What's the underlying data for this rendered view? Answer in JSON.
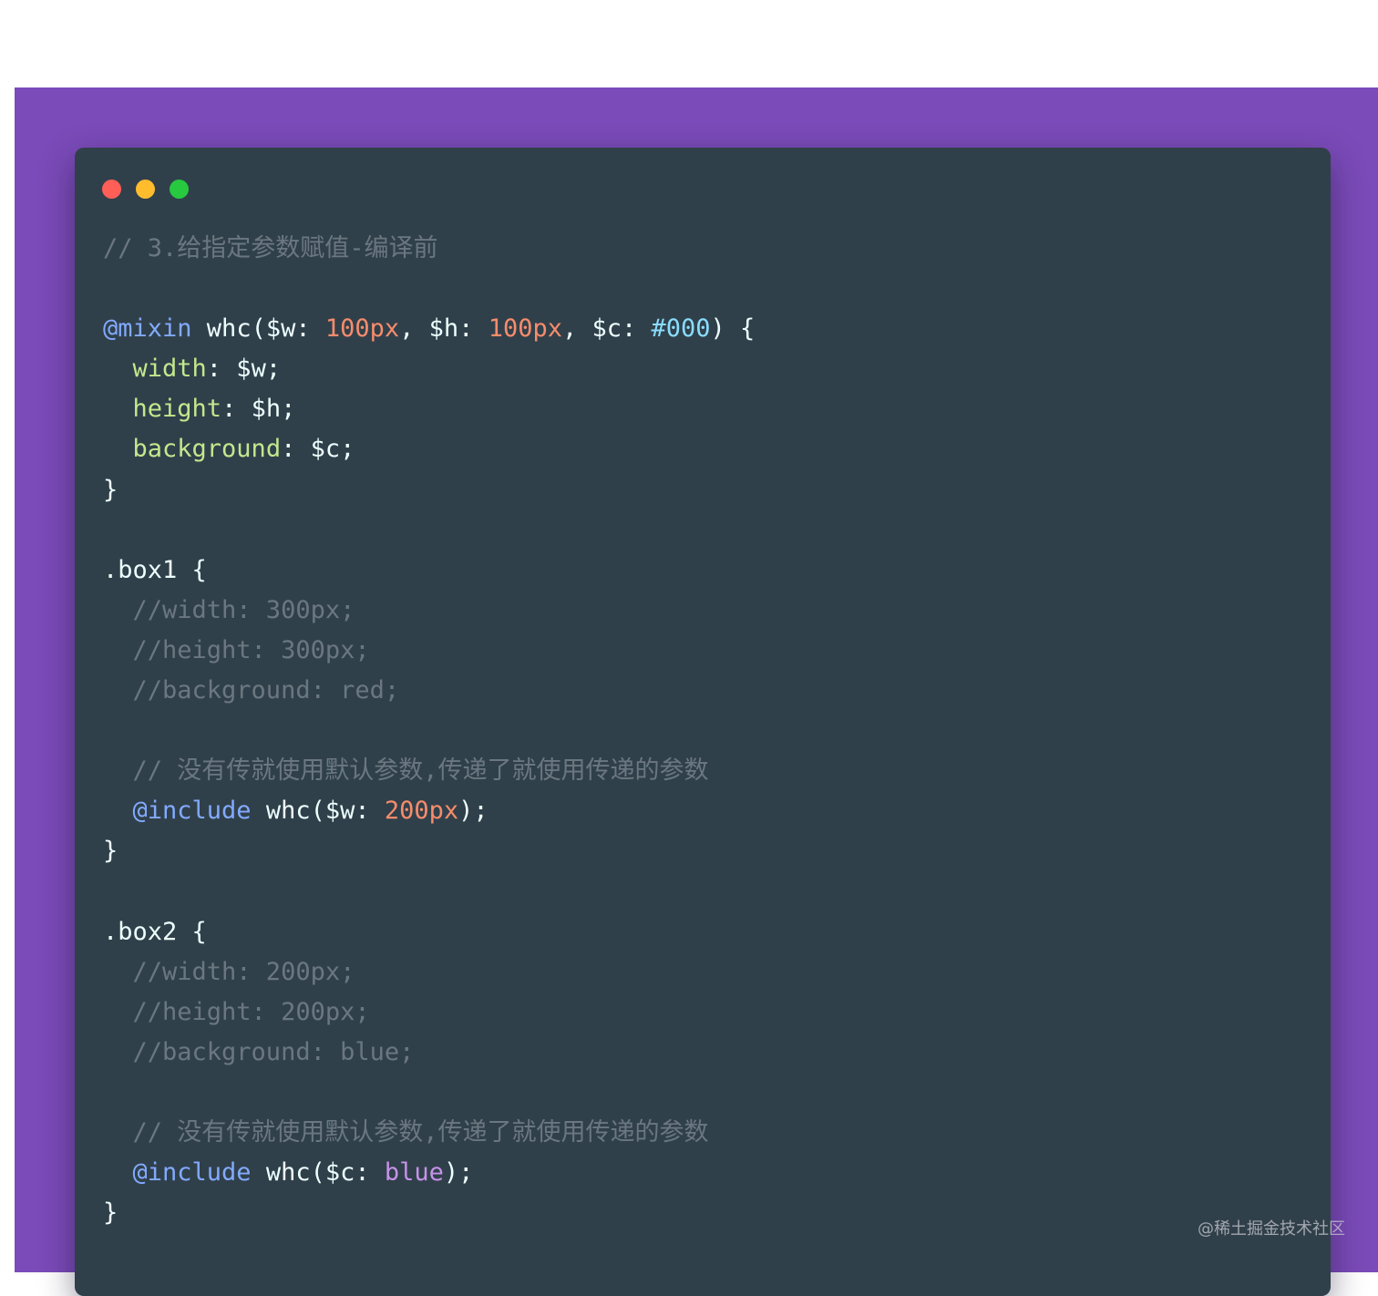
{
  "window": {
    "traffic_lights": [
      {
        "name": "close",
        "color": "#ff5f56"
      },
      {
        "name": "minimize",
        "color": "#ffbd2e"
      },
      {
        "name": "maximize",
        "color": "#27c93f"
      }
    ]
  },
  "colors": {
    "frame_background": "#7b4bb9",
    "card_background": "#30404a",
    "comment": "#6b7780",
    "at_rule": "#82aaff",
    "number": "#f78c6c",
    "hex": "#89ddff",
    "property": "#c3e88d",
    "string": "#c792ea",
    "plain": "#eeffff"
  },
  "code": {
    "lines": [
      [
        {
          "t": "// 3.给指定参数赋值-编译前",
          "k": "comment"
        }
      ],
      [],
      [
        {
          "t": "@mixin",
          "k": "at"
        },
        {
          "t": " whc($w: ",
          "k": "plain"
        },
        {
          "t": "100px",
          "k": "num"
        },
        {
          "t": ", $h: ",
          "k": "plain"
        },
        {
          "t": "100px",
          "k": "num"
        },
        {
          "t": ", $c: ",
          "k": "plain"
        },
        {
          "t": "#000",
          "k": "hex"
        },
        {
          "t": ") {",
          "k": "plain"
        }
      ],
      [
        {
          "t": "  ",
          "k": "plain"
        },
        {
          "t": "width",
          "k": "prop"
        },
        {
          "t": ": $w;",
          "k": "plain"
        }
      ],
      [
        {
          "t": "  ",
          "k": "plain"
        },
        {
          "t": "height",
          "k": "prop"
        },
        {
          "t": ": $h;",
          "k": "plain"
        }
      ],
      [
        {
          "t": "  ",
          "k": "plain"
        },
        {
          "t": "background",
          "k": "prop"
        },
        {
          "t": ": $c;",
          "k": "plain"
        }
      ],
      [
        {
          "t": "}",
          "k": "plain"
        }
      ],
      [],
      [
        {
          "t": ".box1 {",
          "k": "plain"
        }
      ],
      [
        {
          "t": "  //width: 300px;",
          "k": "comment"
        }
      ],
      [
        {
          "t": "  //height: 300px;",
          "k": "comment"
        }
      ],
      [
        {
          "t": "  //background: red;",
          "k": "comment"
        }
      ],
      [],
      [
        {
          "t": "  // 没有传就使用默认参数,传递了就使用传递的参数",
          "k": "comment"
        }
      ],
      [
        {
          "t": "  ",
          "k": "plain"
        },
        {
          "t": "@include",
          "k": "at"
        },
        {
          "t": " whc($w: ",
          "k": "plain"
        },
        {
          "t": "200px",
          "k": "num"
        },
        {
          "t": ");",
          "k": "plain"
        }
      ],
      [
        {
          "t": "}",
          "k": "plain"
        }
      ],
      [],
      [
        {
          "t": ".box2 {",
          "k": "plain"
        }
      ],
      [
        {
          "t": "  //width: 200px;",
          "k": "comment"
        }
      ],
      [
        {
          "t": "  //height: 200px;",
          "k": "comment"
        }
      ],
      [
        {
          "t": "  //background: blue;",
          "k": "comment"
        }
      ],
      [],
      [
        {
          "t": "  // 没有传就使用默认参数,传递了就使用传递的参数",
          "k": "comment"
        }
      ],
      [
        {
          "t": "  ",
          "k": "plain"
        },
        {
          "t": "@include",
          "k": "at"
        },
        {
          "t": " whc($c: ",
          "k": "plain"
        },
        {
          "t": "blue",
          "k": "str"
        },
        {
          "t": ");",
          "k": "plain"
        }
      ],
      [
        {
          "t": "}",
          "k": "plain"
        }
      ]
    ]
  },
  "watermark": "@稀土掘金技术社区"
}
